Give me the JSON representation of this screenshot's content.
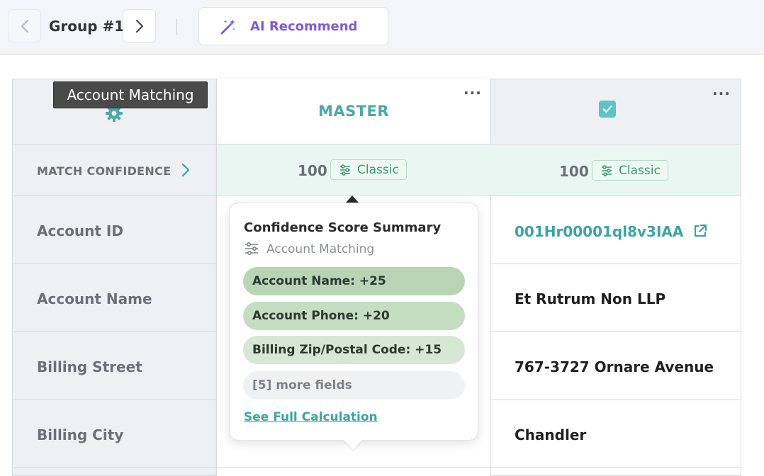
{
  "toolbar": {
    "group_label": "Group #1",
    "ai_label": "AI Recommend"
  },
  "tooltip": {
    "text": "Account Matching"
  },
  "rows": {
    "confidence_label": "MATCH CONFIDENCE",
    "labels": [
      "Account ID",
      "Account Name",
      "Billing Street",
      "Billing City"
    ]
  },
  "master": {
    "title": "MASTER",
    "menu": "···",
    "score": "100",
    "badge": "Classic"
  },
  "record": {
    "menu": "···",
    "score": "100",
    "badge": "Classic",
    "account_id": "001Hr00001ql8v3IAA",
    "account_name": "Et Rutrum Non LLP",
    "billing_street": "767-3727 Ornare Avenue",
    "billing_city": "Chandler"
  },
  "popover": {
    "title": "Confidence Score Summary",
    "subtitle": "Account Matching",
    "items": [
      "Account Name: +25",
      "Account Phone: +20",
      "Billing Zip/Postal Code: +15"
    ],
    "more": "[5] more fields",
    "link": "See Full Calculation"
  },
  "colors": {
    "accent_teal": "#4aa9a3",
    "ai_purple": "#7b5ce0",
    "classic_green": "#3a9a6a",
    "confidence_row_bg": "#eaf6f2"
  },
  "icons": [
    "chevron-left-icon",
    "chevron-right-icon",
    "magic-wand-icon",
    "gear-icon",
    "sliders-icon",
    "checkbox-checked-icon",
    "external-link-icon"
  ]
}
